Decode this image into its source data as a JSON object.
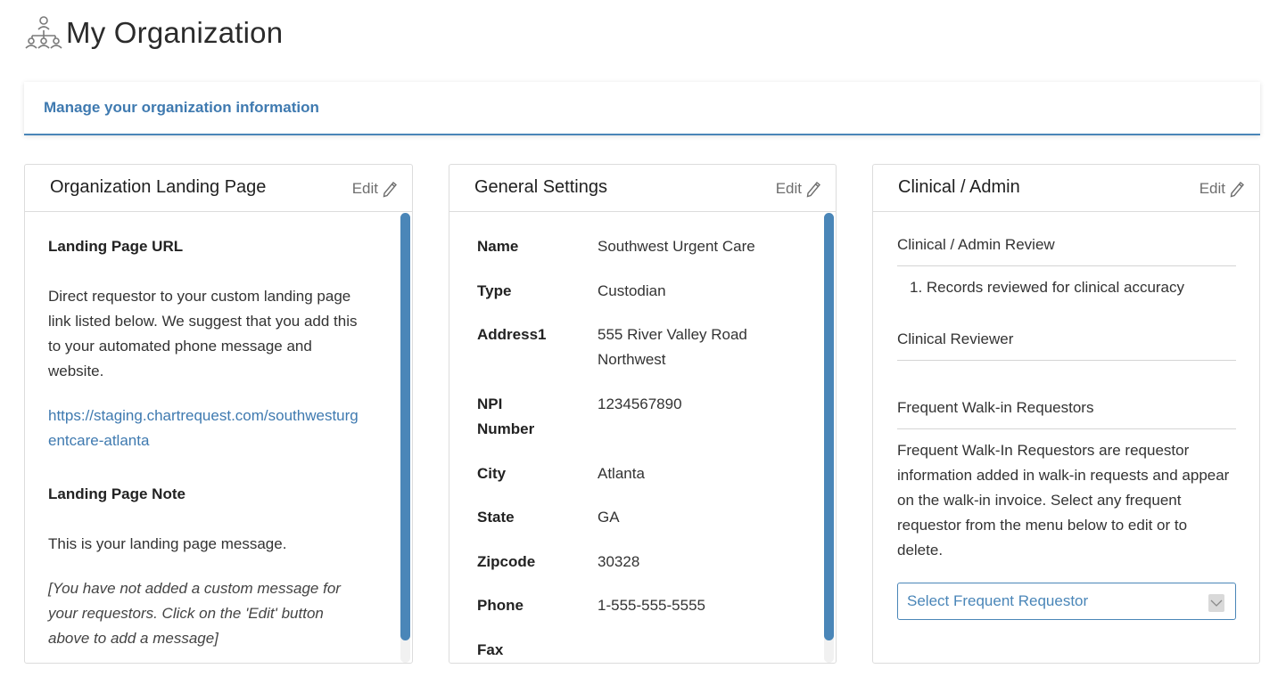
{
  "page": {
    "title": "My Organization",
    "icon": "org-chart-icon"
  },
  "subheader": {
    "text": "Manage your organization information"
  },
  "accent_color": "#4a86b8",
  "landing_card": {
    "title": "Organization Landing Page",
    "edit_label": "Edit",
    "url_label": "Landing Page URL",
    "url_description": "Direct requestor to your custom landing page link listed below. We suggest that you add this to your automated phone message and website.",
    "url": "https://staging.chartrequest.com/southwesturgentcare-atlanta",
    "note_label": "Landing Page Note",
    "note_text": "This is your landing page message.",
    "note_placeholder": "[You have not added a custom message for your requestors. Click on the 'Edit' button above to add a message]"
  },
  "general_card": {
    "title": "General Settings",
    "edit_label": "Edit",
    "fields": [
      {
        "label": "Name",
        "value": "Southwest Urgent Care"
      },
      {
        "label": "Type",
        "value": "Custodian"
      },
      {
        "label": "Address1",
        "value": "555 River Valley Road Northwest"
      },
      {
        "label": "NPI Number",
        "value": "1234567890"
      },
      {
        "label": "City",
        "value": "Atlanta"
      },
      {
        "label": "State",
        "value": "GA"
      },
      {
        "label": "Zipcode",
        "value": "30328"
      },
      {
        "label": "Phone",
        "value": "1-555-555-5555"
      },
      {
        "label": "Fax",
        "value": ""
      }
    ]
  },
  "clinical_card": {
    "title": "Clinical / Admin",
    "edit_label": "Edit",
    "review_heading": "Clinical / Admin Review",
    "review_items": [
      "Records reviewed for clinical accuracy"
    ],
    "reviewer_heading": "Clinical Reviewer",
    "walkin_heading": "Frequent Walk-in Requestors",
    "walkin_description": "Frequent Walk-In Requestors are requestor information added in walk-in requests and appear on the walk-in invoice. Select any frequent requestor from the menu below to edit or to delete.",
    "select_placeholder": "Select Frequent Requestor"
  }
}
